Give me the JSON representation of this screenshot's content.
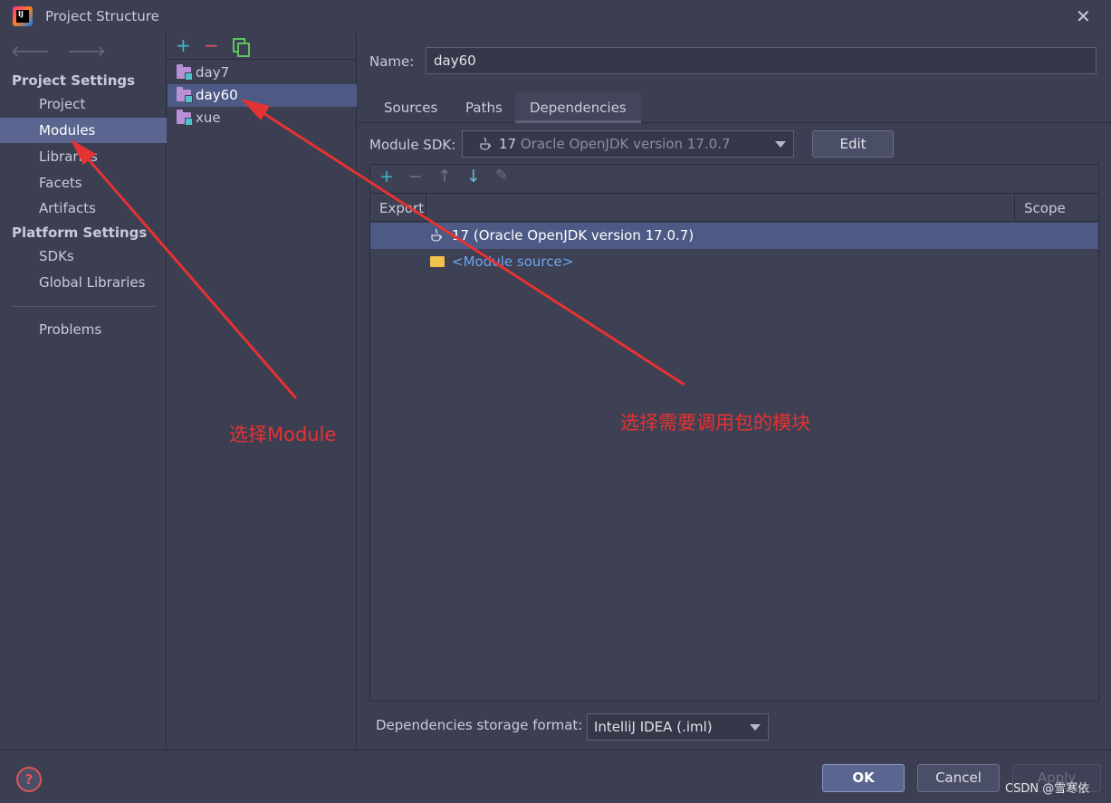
{
  "window": {
    "title": "Project Structure"
  },
  "sidebar": {
    "nav_back": "🡐",
    "nav_forward": "🡒",
    "project_settings_header": "Project Settings",
    "platform_settings_header": "Platform Settings",
    "items": [
      {
        "label": "Project"
      },
      {
        "label": "Modules"
      },
      {
        "label": "Libraries"
      },
      {
        "label": "Facets"
      },
      {
        "label": "Artifacts"
      },
      {
        "label": "SDKs"
      },
      {
        "label": "Global Libraries"
      },
      {
        "label": "Problems"
      }
    ],
    "selected": "Modules"
  },
  "modules": {
    "toolbar": {
      "add": "+",
      "remove": "−"
    },
    "items": [
      {
        "label": "day7"
      },
      {
        "label": "day60"
      },
      {
        "label": "xue"
      }
    ],
    "selected": "day60"
  },
  "detail": {
    "name_label": "Name:",
    "name_value": "day60",
    "tabs": [
      {
        "label": "Sources"
      },
      {
        "label": "Paths"
      },
      {
        "label": "Dependencies"
      }
    ],
    "active_tab": "Dependencies",
    "sdk_label": "Module SDK:",
    "sdk_num": "17",
    "sdk_rest": "Oracle OpenJDK version 17.0.7",
    "edit_label": "Edit",
    "deps_toolbar": {
      "add": "+",
      "remove": "−",
      "up": "↑",
      "down": "↓",
      "edit": "✎"
    },
    "columns": {
      "export": "Export",
      "scope": "Scope"
    },
    "rows": [
      {
        "label": "17 (Oracle OpenJDK version 17.0.7)"
      },
      {
        "label": "<Module source>"
      }
    ],
    "storage_label": "Dependencies storage format:",
    "storage_value": "IntelliJ IDEA (.iml)"
  },
  "footer": {
    "help": "?",
    "ok": "OK",
    "cancel": "Cancel",
    "apply": "Apply",
    "watermark": "CSDN @雪寒依"
  },
  "annotations": {
    "left": "选择Module",
    "right": "选择需要调用包的模块"
  },
  "colors": {
    "accent_selection": "#5b6690",
    "annotation": "#e53232"
  }
}
